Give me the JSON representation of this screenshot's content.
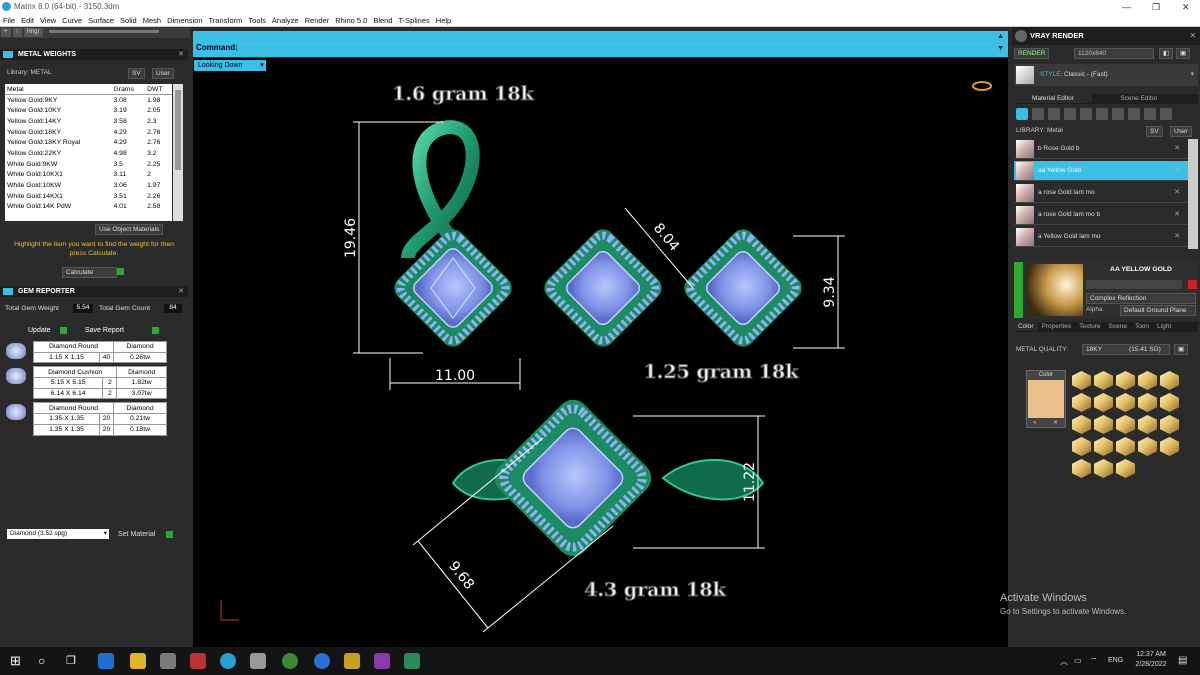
{
  "window": {
    "title": "Matrix 8.0 (64-bit) - 3150.3dm",
    "minimize": "—",
    "maximize": "❐",
    "close": "✕"
  },
  "menu": [
    "File",
    "Edit",
    "View",
    "Curve",
    "Surface",
    "Solid",
    "Mesh",
    "Dimension",
    "Transform",
    "Tools",
    "Analyze",
    "Render",
    "Rhino 5.0",
    "Blend",
    "T-Splines",
    "Help"
  ],
  "toolstrip": [
    "+",
    "↑",
    "Hngr"
  ],
  "metal_weights": {
    "title": "METAL WEIGHTS",
    "library_label": "Library: METAL",
    "sv": "SV",
    "user": "User",
    "columns": [
      "Metal",
      "Grams",
      "DWT"
    ],
    "rows": [
      [
        "Yellow Gold:9KY",
        "3.08",
        "1.98"
      ],
      [
        "Yellow Gold:10KY",
        "3.19",
        "2.05"
      ],
      [
        "Yellow Gold:14KY",
        "3.58",
        "2.3"
      ],
      [
        "Yellow Gold:18KY",
        "4.29",
        "2.76"
      ],
      [
        "Yellow Gold:18KY Royal",
        "4.29",
        "2.76"
      ],
      [
        "Yellow Gold:22KY",
        "4.98",
        "3.2"
      ],
      [
        "White Gold:9KW",
        "3.5",
        "2.25"
      ],
      [
        "White Gold:10KX1",
        "3.11",
        "2"
      ],
      [
        "White Gold:10KW",
        "3.06",
        "1.97"
      ],
      [
        "White Gold:14KX1",
        "3.51",
        "2.26"
      ],
      [
        "White Gold:14K PdW",
        "4.01",
        "2.58"
      ]
    ],
    "use_object_materials": "Use Object Materials",
    "hint": "Highlight the item you want to find the weight for then press Calculate.",
    "calculate": "Calculate"
  },
  "gem_reporter": {
    "title": "GEM REPORTER",
    "total_weight_label": "Total Gem Weight",
    "total_weight": "5.54",
    "total_count_label": "Total Gem Count",
    "total_count": "84",
    "update": "Update",
    "save_report": "Save Report",
    "groups": [
      {
        "name": "Diamond Round",
        "type": "Diamond",
        "rows": [
          [
            "1.15 X 1.15",
            "40",
            "0.26tw"
          ]
        ]
      },
      {
        "name": "Diamond Cushion",
        "type": "Diamond",
        "rows": [
          [
            "5.15 X 5.15",
            "2",
            "1.82tw"
          ],
          [
            "6.14 X 6.14",
            "2",
            "3.07tw"
          ]
        ]
      },
      {
        "name": "Diamond Round",
        "type": "Diamond",
        "rows": [
          [
            "1.35 X 1.35",
            "20",
            "0.21tw"
          ],
          [
            "1.35 X 1.35",
            "20",
            "0.18tw"
          ]
        ]
      }
    ],
    "material_select": "Diamond     (3.52 spg)",
    "set_material": "Set Material"
  },
  "command": {
    "label": "Command:"
  },
  "viewport": {
    "view_name": "Looking Down",
    "annotations": {
      "pendant_weight": "1.6 gram 18k",
      "earring_weight": "1.25 gram 18k",
      "ring_weight": "4.3 gram 18k",
      "pendant_height": "19.46",
      "pendant_width": "11.00",
      "earring_height": "9.34",
      "earring_diag": "8.04",
      "ring_height": "11.22",
      "ring_diag": "9.68"
    }
  },
  "vray": {
    "title": "VRAY RENDER",
    "render": "RENDER",
    "resolution": "1120x840",
    "style_label": "STYLE:",
    "style": "Classic - (Fast)",
    "tabs": [
      "Material Editor",
      "Scene Editor"
    ],
    "library": "LIBRARY: Metal",
    "sv": "SV",
    "user": "User",
    "materials": [
      "b Rose Gold b",
      "aa Yellow Gold",
      "a rose Gold lam mo",
      "a rose Gold lam mo b",
      "a Yellow Gold lam mo"
    ],
    "selected_material": "AA YELLOW GOLD",
    "reflection": "Complex Reflection",
    "alpha": "Alpha",
    "ground": "Default Ground Plane",
    "subtabs": [
      "Color",
      "Properties",
      "Texture",
      "Scene",
      "Toon",
      "Light"
    ],
    "metal_quality_label": "METAL QUALITY:",
    "metal_quality": "18KY",
    "metal_quality_sg": "(15.41 SG)",
    "color_label": "Color",
    "swatch_color": "#e9c08a"
  },
  "activate": {
    "title": "Activate Windows",
    "sub": "Go to Settings to activate Windows."
  },
  "taskbar": {
    "time": "12:37 AM",
    "date": "2/28/2022",
    "lang": "ENG"
  }
}
